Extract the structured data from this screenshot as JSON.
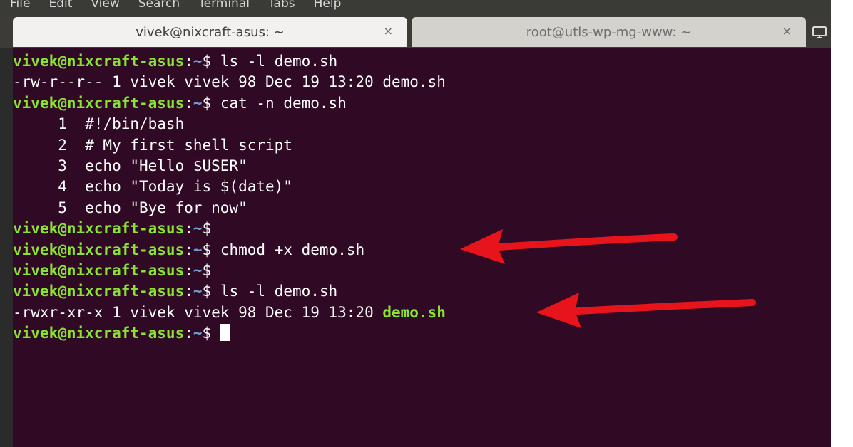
{
  "menu": [
    "File",
    "Edit",
    "View",
    "Search",
    "Terminal",
    "Tabs",
    "Help"
  ],
  "tabs": [
    {
      "title": "vivek@nixcraft-asus: ~",
      "close": "×"
    },
    {
      "title": "root@utls-wp-mg-www: ~",
      "close": "×"
    }
  ],
  "prompt": {
    "user": "vivek@nixcraft-asus",
    "colon": ":",
    "path": "~",
    "dollar": "$"
  },
  "lines": [
    {
      "cmd": " ls -l demo.sh"
    },
    {
      "out": "-rw-r--r-- 1 vivek vivek 98 Dec 19 13:20 demo.sh"
    },
    {
      "cmd": " cat -n demo.sh"
    },
    {
      "out": "     1  #!/bin/bash"
    },
    {
      "out": "     2  # My first shell script"
    },
    {
      "out": "     3  echo \"Hello $USER\""
    },
    {
      "out": "     4  echo \"Today is $(date)\""
    },
    {
      "out": "     5  echo \"Bye for now\""
    },
    {
      "cmd": ""
    },
    {
      "cmd": " chmod +x demo.sh"
    },
    {
      "cmd": ""
    },
    {
      "cmd": " ls -l demo.sh"
    },
    {
      "out": "-rwxr-xr-x 1 vivek vivek 98 Dec 19 13:20 ",
      "file": "demo.sh"
    },
    {
      "cmd": " ",
      "cursor": true
    }
  ],
  "colors": {
    "terminal_bg": "#300a24",
    "prompt_user": "#8ae234",
    "prompt_path": "#729fcf",
    "annotation_arrow": "#e8141b"
  }
}
